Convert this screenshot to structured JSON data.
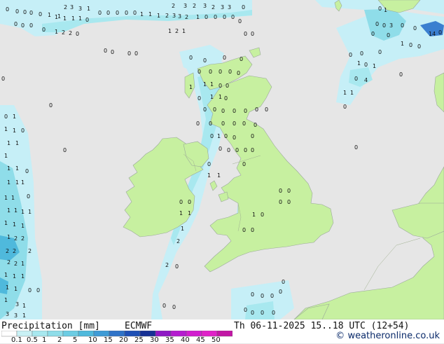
{
  "header": {
    "title": "Precipitation [mm]",
    "model": "ECMWF",
    "valid_time": "Th 06-11-2025 15..18 UTC (12+54)"
  },
  "credit": {
    "symbol": "©",
    "text": "weatheronline.co.uk"
  },
  "legend": {
    "ticks": [
      "0.1",
      "0.5",
      "1",
      "2",
      "5",
      "10",
      "15",
      "20",
      "25",
      "30",
      "35",
      "40",
      "45",
      "50"
    ],
    "colors": [
      "#ffffff",
      "#c9f1f5",
      "#a8e8ef",
      "#8fdde9",
      "#6ccce3",
      "#4fb9dc",
      "#3f9bd6",
      "#2f73c8",
      "#1e4fb5",
      "#173095",
      "#8f18c4",
      "#b51bcf",
      "#d21dcf",
      "#e022c8",
      "#c217a5"
    ]
  },
  "colors": {
    "land": "#c7f0a0",
    "sea": "#e6e6e6",
    "rain_light": "#c6eff7",
    "rain_mod": "#8fdde9",
    "rain_heavy": "#3a7fd0",
    "coast": "#9aa89a"
  },
  "map": {
    "labels": [
      [
        "0",
        8,
        9
      ],
      [
        "0",
        22,
        12
      ],
      [
        "0",
        33,
        13
      ],
      [
        "0",
        42,
        14
      ],
      [
        "0",
        55,
        16
      ],
      [
        "1",
        68,
        17
      ],
      [
        "1",
        82,
        19
      ],
      [
        "2",
        91,
        6
      ],
      [
        "3",
        100,
        6
      ],
      [
        "3",
        112,
        8
      ],
      [
        "1",
        124,
        8
      ],
      [
        "0",
        140,
        14
      ],
      [
        "0",
        152,
        14
      ],
      [
        "0",
        165,
        14
      ],
      [
        "0",
        178,
        14
      ],
      [
        "0",
        190,
        14
      ],
      [
        "1",
        200,
        16
      ],
      [
        "1",
        212,
        16
      ],
      [
        "1",
        224,
        18
      ],
      [
        "2",
        236,
        18
      ],
      [
        "3",
        246,
        18
      ],
      [
        "3",
        254,
        19
      ],
      [
        "2",
        264,
        20
      ],
      [
        "1",
        280,
        20
      ],
      [
        "0",
        292,
        20
      ],
      [
        "0",
        305,
        20
      ],
      [
        "0",
        318,
        20
      ],
      [
        "0",
        330,
        20
      ],
      [
        "2",
        245,
        4
      ],
      [
        "3",
        262,
        4
      ],
      [
        "2",
        275,
        4
      ],
      [
        "3",
        290,
        4
      ],
      [
        "2",
        302,
        6
      ],
      [
        "3",
        315,
        6
      ],
      [
        "3",
        325,
        6
      ],
      [
        "0",
        345,
        6
      ],
      [
        "1",
        78,
        20
      ],
      [
        "1",
        90,
        22
      ],
      [
        "1",
        102,
        22
      ],
      [
        "1",
        112,
        22
      ],
      [
        "0",
        122,
        24
      ],
      [
        "0",
        20,
        30
      ],
      [
        "0",
        30,
        32
      ],
      [
        "0",
        42,
        32
      ],
      [
        "1",
        78,
        41
      ],
      [
        "2",
        88,
        42
      ],
      [
        "2",
        98,
        43
      ],
      [
        "0",
        108,
        44
      ],
      [
        "1",
        240,
        40
      ],
      [
        "2",
        250,
        40
      ],
      [
        "1",
        260,
        40
      ],
      [
        "0",
        340,
        26
      ],
      [
        "0",
        348,
        44
      ],
      [
        "0",
        358,
        44
      ],
      [
        "0",
        60,
        38
      ],
      [
        "0",
        148,
        68
      ],
      [
        "0",
        158,
        70
      ],
      [
        "0",
        182,
        72
      ],
      [
        "0",
        192,
        72
      ],
      [
        "0",
        270,
        78
      ],
      [
        "0",
        290,
        82
      ],
      [
        "0",
        318,
        78
      ],
      [
        "0",
        342,
        80
      ],
      [
        "0",
        282,
        98
      ],
      [
        "0",
        298,
        98
      ],
      [
        "0",
        312,
        98
      ],
      [
        "0",
        326,
        98
      ],
      [
        "0",
        338,
        100
      ],
      [
        "1",
        270,
        120
      ],
      [
        "1",
        290,
        116
      ],
      [
        "1",
        300,
        116
      ],
      [
        "0",
        312,
        118
      ],
      [
        "0",
        322,
        118
      ],
      [
        "0",
        282,
        136
      ],
      [
        "1",
        300,
        134
      ],
      [
        "1",
        312,
        134
      ],
      [
        "0",
        320,
        136
      ],
      [
        "0",
        290,
        152
      ],
      [
        "0",
        304,
        152
      ],
      [
        "0",
        316,
        154
      ],
      [
        "0",
        332,
        154
      ],
      [
        "0",
        348,
        154
      ],
      [
        "0",
        364,
        152
      ],
      [
        "0",
        378,
        152
      ],
      [
        "0",
        280,
        172
      ],
      [
        "0",
        298,
        172
      ],
      [
        "0",
        316,
        172
      ],
      [
        "0",
        332,
        172
      ],
      [
        "0",
        346,
        172
      ],
      [
        "0",
        362,
        174
      ],
      [
        "0",
        300,
        190
      ],
      [
        "1",
        310,
        190
      ],
      [
        "0",
        320,
        190
      ],
      [
        "0",
        332,
        192
      ],
      [
        "0",
        358,
        190
      ],
      [
        "0",
        312,
        208
      ],
      [
        "0",
        324,
        210
      ],
      [
        "0",
        336,
        210
      ],
      [
        "0",
        348,
        210
      ],
      [
        "0",
        358,
        210
      ],
      [
        "0",
        296,
        230
      ],
      [
        "0",
        346,
        230
      ],
      [
        "1",
        296,
        246
      ],
      [
        "1",
        310,
        246
      ],
      [
        "0",
        90,
        210
      ],
      [
        "0",
        70,
        146
      ],
      [
        "0",
        2,
        108
      ],
      [
        "0",
        398,
        268
      ],
      [
        "0",
        410,
        268
      ],
      [
        "0",
        398,
        284
      ],
      [
        "0",
        410,
        284
      ],
      [
        "0",
        256,
        284
      ],
      [
        "0",
        268,
        284
      ],
      [
        "1",
        256,
        300
      ],
      [
        "1",
        268,
        300
      ],
      [
        "1",
        258,
        322
      ],
      [
        "1",
        360,
        302
      ],
      [
        "0",
        372,
        302
      ],
      [
        "0",
        346,
        324
      ],
      [
        "0",
        358,
        324
      ],
      [
        "2",
        252,
        340
      ],
      [
        "2",
        236,
        374
      ],
      [
        "0",
        250,
        376
      ],
      [
        "0",
        232,
        432
      ],
      [
        "0",
        246,
        434
      ],
      [
        "0",
        358,
        416
      ],
      [
        "0",
        372,
        418
      ],
      [
        "0",
        386,
        418
      ],
      [
        "0",
        398,
        412
      ],
      [
        "0",
        402,
        398
      ],
      [
        "0",
        348,
        438
      ],
      [
        "0",
        358,
        442
      ],
      [
        "0",
        372,
        442
      ],
      [
        "0",
        388,
        442
      ],
      [
        "0",
        6,
        162
      ],
      [
        "1",
        18,
        162
      ],
      [
        "1",
        6,
        180
      ],
      [
        "1",
        18,
        182
      ],
      [
        "0",
        30,
        182
      ],
      [
        "1",
        10,
        200
      ],
      [
        "1",
        22,
        200
      ],
      [
        "1",
        6,
        218
      ],
      [
        "1",
        10,
        236
      ],
      [
        "1",
        22,
        236
      ],
      [
        "0",
        36,
        240
      ],
      [
        "1",
        10,
        256
      ],
      [
        "1",
        22,
        256
      ],
      [
        "1",
        30,
        256
      ],
      [
        "0",
        38,
        276
      ],
      [
        "1",
        6,
        278
      ],
      [
        "1",
        16,
        278
      ],
      [
        "1",
        10,
        296
      ],
      [
        "1",
        20,
        296
      ],
      [
        "1",
        30,
        298
      ],
      [
        "1",
        40,
        298
      ],
      [
        "1",
        6,
        314
      ],
      [
        "1",
        18,
        316
      ],
      [
        "1",
        30,
        318
      ],
      [
        "1",
        10,
        334
      ],
      [
        "2",
        20,
        336
      ],
      [
        "2",
        30,
        336
      ],
      [
        "2",
        40,
        354
      ],
      [
        "2",
        8,
        354
      ],
      [
        "2",
        18,
        354
      ],
      [
        "1",
        30,
        372
      ],
      [
        "2",
        10,
        370
      ],
      [
        "2",
        20,
        372
      ],
      [
        "1",
        6,
        388
      ],
      [
        "1",
        18,
        390
      ],
      [
        "1",
        30,
        390
      ],
      [
        "0",
        40,
        410
      ],
      [
        "1",
        8,
        406
      ],
      [
        "1",
        20,
        408
      ],
      [
        "0",
        52,
        410
      ],
      [
        "1",
        6,
        424
      ],
      [
        "3",
        22,
        430
      ],
      [
        "1",
        32,
        432
      ],
      [
        "3",
        8,
        444
      ],
      [
        "3",
        20,
        446
      ],
      [
        "1",
        32,
        446
      ],
      [
        "0",
        540,
        8
      ],
      [
        "1",
        548,
        10
      ],
      [
        "0",
        536,
        30
      ],
      [
        "0",
        546,
        32
      ],
      [
        "3",
        556,
        32
      ],
      [
        "0",
        572,
        32
      ],
      [
        "0",
        530,
        44
      ],
      [
        "0",
        552,
        46
      ],
      [
        "1",
        572,
        58
      ],
      [
        "0",
        584,
        60
      ],
      [
        "0",
        596,
        62
      ],
      [
        "1",
        510,
        86
      ],
      [
        "0",
        520,
        88
      ],
      [
        "1",
        532,
        90
      ],
      [
        "4",
        520,
        110
      ],
      [
        "0",
        506,
        108
      ],
      [
        "0",
        570,
        102
      ],
      [
        "1",
        490,
        128
      ],
      [
        "1",
        500,
        128
      ],
      [
        "0",
        490,
        148
      ],
      [
        "0",
        506,
        206
      ],
      [
        "0",
        498,
        74
      ],
      [
        "0",
        514,
        72
      ],
      [
        "0",
        540,
        70
      ],
      [
        "0",
        590,
        36
      ],
      [
        "14",
        612,
        44
      ],
      [
        "0",
        626,
        42
      ]
    ]
  }
}
